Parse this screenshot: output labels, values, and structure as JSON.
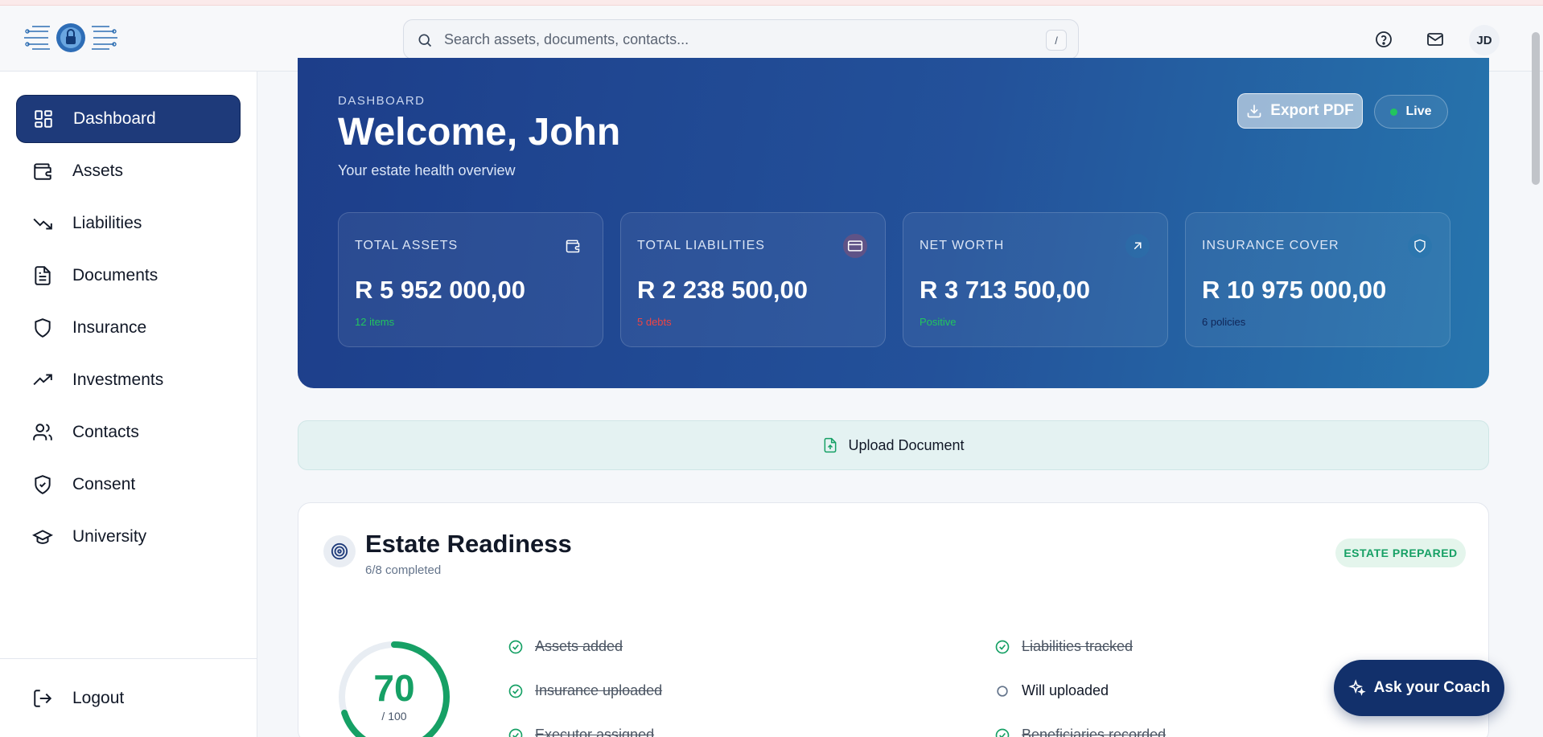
{
  "header": {
    "search_placeholder": "Search assets, documents, contacts...",
    "search_shortcut": "/",
    "avatar_initials": "JD"
  },
  "sidebar": {
    "items": [
      {
        "label": "Dashboard",
        "icon": "dashboard-icon",
        "active": true
      },
      {
        "label": "Assets",
        "icon": "wallet-icon"
      },
      {
        "label": "Liabilities",
        "icon": "trending-down-icon"
      },
      {
        "label": "Documents",
        "icon": "document-icon"
      },
      {
        "label": "Insurance",
        "icon": "shield-icon"
      },
      {
        "label": "Investments",
        "icon": "trending-up-icon"
      },
      {
        "label": "Contacts",
        "icon": "users-icon"
      },
      {
        "label": "Consent",
        "icon": "shield-check-icon"
      },
      {
        "label": "University",
        "icon": "graduation-cap-icon"
      }
    ],
    "logout_label": "Logout"
  },
  "hero": {
    "eyebrow": "DASHBOARD",
    "title": "Welcome, John",
    "subtitle": "Your estate health overview",
    "export_label": "Export PDF",
    "live_label": "Live",
    "stats": [
      {
        "label": "TOTAL ASSETS",
        "value": "R 5 952 000,00",
        "note": "12 items",
        "note_color": "#22c55e",
        "icon": "wallet-icon"
      },
      {
        "label": "TOTAL LIABILITIES",
        "value": "R 2 238 500,00",
        "note": "5 debts",
        "note_color": "#ef4444",
        "icon": "credit-card-icon"
      },
      {
        "label": "NET WORTH",
        "value": "R 3 713 500,00",
        "note": "Positive",
        "note_color": "#22c55e",
        "icon": "arrow-up-right-icon"
      },
      {
        "label": "INSURANCE COVER",
        "value": "R 10 975 000,00",
        "note": "6 policies",
        "note_color": "#0f2557",
        "icon": "shield-icon"
      }
    ]
  },
  "upload": {
    "label": "Upload Document"
  },
  "readiness": {
    "title": "Estate Readiness",
    "subtitle": "6/8 completed",
    "badge": "ESTATE PREPARED",
    "score": "70",
    "score_max": "/ 100",
    "score_fraction": 0.7,
    "items": [
      {
        "label": "Assets added",
        "done": true
      },
      {
        "label": "Liabilities tracked",
        "done": true
      },
      {
        "label": "Insurance uploaded",
        "done": true
      },
      {
        "label": "Will uploaded",
        "done": false
      },
      {
        "label": "Executor assigned",
        "done": true
      },
      {
        "label": "Beneficiaries recorded",
        "done": true
      }
    ]
  },
  "coach": {
    "label": "Ask your Coach"
  },
  "colors": {
    "primary": "#1e3a7a",
    "success": "#16a065",
    "danger": "#ef4444"
  }
}
